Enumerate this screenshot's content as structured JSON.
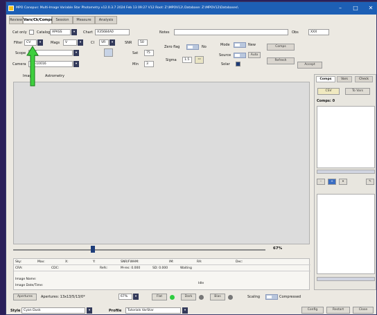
{
  "window": {
    "title": "MPO Canopus: Multi-Image Variable Star Photometry   v12.0.3.7  2024 Feb 13 09:27    V12 Root: Z:\\MPOV12\\   Database: Z:\\MPOV12\\Databases\\",
    "min": "–",
    "max": "□",
    "close": "✕"
  },
  "tabs": [
    "Review",
    "Vars/Ck/Comps",
    "Session",
    "Measure",
    "Analysis"
  ],
  "tab_active": 1,
  "form": {
    "cat_only": "Cat only",
    "catalog_label": "Catalog",
    "catalog_value": "APASS",
    "chart_label": "Chart",
    "chart_value": "X35684A0",
    "notes_label": "Notes",
    "notes_value": "",
    "obs_label": "Obs",
    "obs_value": "XXX",
    "filter_label": "Filter",
    "filter_value": "CV",
    "mags_label": "Mags",
    "mags_value": "V",
    "ci_label": "CI",
    "ci_value": "VR",
    "snr_label": "SNR",
    "snr_value": "50",
    "scope_label": "Scope",
    "scope_value": "SCT",
    "sat_label": "Sat",
    "sat_value": "75",
    "camera_label": "Camera",
    "camera_value": "ML-10016",
    "min_label": "Min",
    "min_value": "3",
    "zero_flag_label": "Zero flag",
    "zero_flag_value": "No",
    "sigma_label": "Sigma",
    "sigma_value": "1.5",
    "mode_label": "Mode",
    "mode_value": "New",
    "source_label": "Source",
    "source_value": "Auto",
    "solar_label": "Solar",
    "comps_btn": "Comps",
    "refresh_btn": "Refresh",
    "accept_btn": "Accept"
  },
  "subtabs": [
    "Image",
    "Astrometry"
  ],
  "slider": {
    "percent": "67%",
    "position": 0.31
  },
  "info": {
    "row1": [
      "Sky:",
      "Max:",
      "X:",
      "Y:",
      "SNR/FWHM:",
      "IM:",
      "RA:",
      "Dec:"
    ],
    "row2": [
      "CRA:",
      "CDC:",
      "Refs:",
      "M-res: 0.000",
      "SD: 0.000",
      "Waiting"
    ],
    "image_name": "Image Name:",
    "image_date": "Image Date/Time:",
    "status": "Idle"
  },
  "right_panel": {
    "tabs": [
      "Comps",
      "Vars",
      "Check"
    ],
    "csv_btn": "CSV",
    "to_vars_btn": "To Vars",
    "comps_count": "Comps: 0"
  },
  "bottom": {
    "apertures_btn": "Apertures",
    "apertures_label": "Apertures: 13x13/5/13/0*",
    "zoom_value": "67%",
    "flat_btn": "Flat",
    "dark_btn": "Dark",
    "bias_btn": "Bias",
    "scaling_label": "Scaling",
    "compressed_label": "Compressed"
  },
  "status": {
    "style_label": "Style",
    "style_value": "Cyan Dusk",
    "profile_label": "Profile",
    "profile_value": "Tutorials VarStar",
    "config_btn": "Config",
    "restart_btn": "Restart",
    "close_btn": "Close"
  },
  "colors": {
    "titlebar": "#1d5fb5",
    "arrow": "#3ecf3e",
    "flat_dot": "#2ecc40"
  }
}
